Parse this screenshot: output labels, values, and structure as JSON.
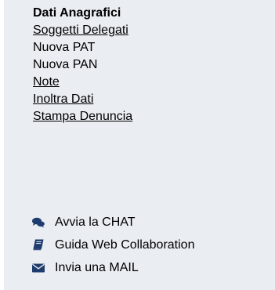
{
  "menu": {
    "items": [
      {
        "label": "Dati Anagrafici",
        "style": "bold"
      },
      {
        "label": "Soggetti Delegati",
        "style": "link"
      },
      {
        "label": "Nuova PAT",
        "style": "plain"
      },
      {
        "label": "Nuova PAN",
        "style": "plain"
      },
      {
        "label": "Note",
        "style": "link"
      },
      {
        "label": "Inoltra Dati",
        "style": "link"
      },
      {
        "label": "Stampa Denuncia",
        "style": "link"
      }
    ]
  },
  "support": {
    "items": [
      {
        "label": "Avvia la CHAT",
        "icon": "chat-bubbles-icon"
      },
      {
        "label": "Guida Web Collaboration",
        "icon": "book-icon"
      },
      {
        "label": "Invia una MAIL",
        "icon": "envelope-icon"
      }
    ]
  },
  "colors": {
    "panel_background": "#eaedf2",
    "icon_color": "#1f3c6e",
    "text_color": "#000000"
  }
}
